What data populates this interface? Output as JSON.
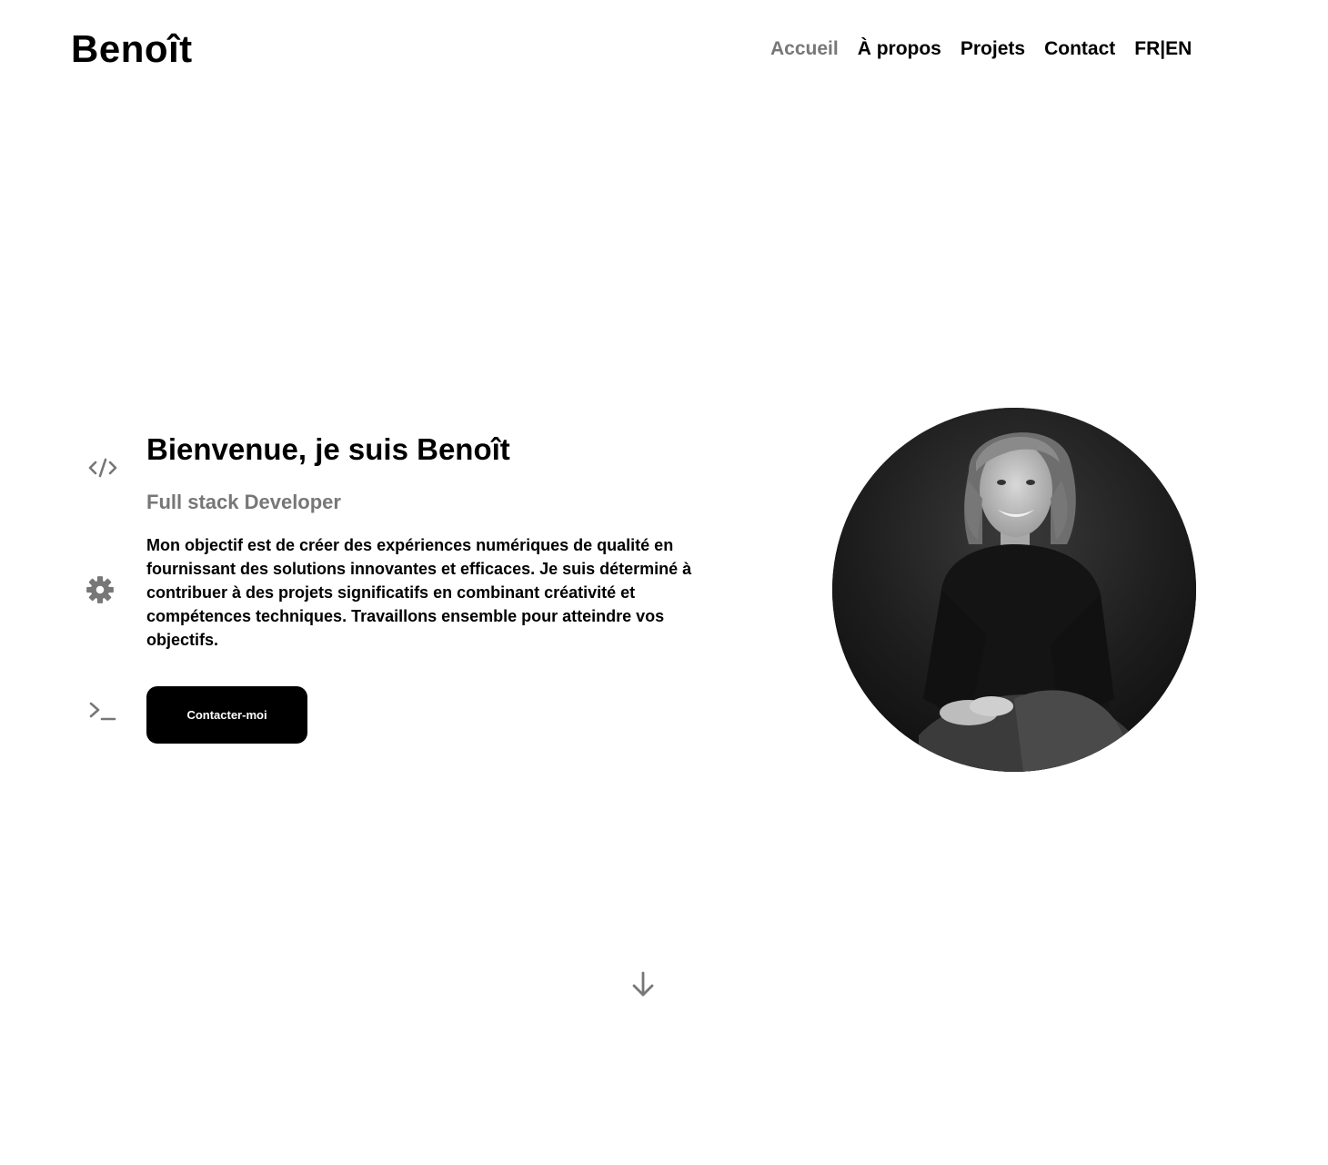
{
  "header": {
    "logo": "Benoît",
    "nav": [
      {
        "label": "Accueil",
        "active": true
      },
      {
        "label": "À propos",
        "active": false
      },
      {
        "label": "Projets",
        "active": false
      },
      {
        "label": "Contact",
        "active": false
      }
    ],
    "lang": {
      "fr": "FR",
      "separator": "|",
      "en": "EN"
    }
  },
  "hero": {
    "title": "Bienvenue, je suis Benoît",
    "subtitle": "Full stack Developer",
    "description": "Mon objectif est de créer des expériences numériques de qualité en fournissant des solutions innovantes et efficaces. Je suis déterminé à contribuer à des projets significatifs en combinant créativité et compétences techniques. Travaillons ensemble pour atteindre vos objectifs.",
    "cta_label": "Contacter-moi"
  },
  "side_icons": [
    "code-icon",
    "gear-icon",
    "terminal-icon"
  ],
  "scroll_icon": "arrow-down-icon",
  "colors": {
    "text": "#000000",
    "muted": "#777777",
    "button_bg": "#000000",
    "button_text": "#ffffff",
    "background": "#ffffff"
  }
}
